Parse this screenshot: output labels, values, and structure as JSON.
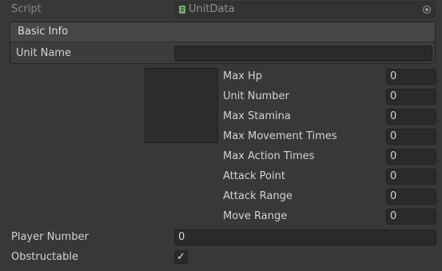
{
  "script": {
    "label": "Script",
    "value": "UnitData"
  },
  "basic_info": {
    "header": "Basic Info",
    "unit_name_label": "Unit Name",
    "unit_name_value": ""
  },
  "stats": [
    {
      "label": "Max Hp",
      "value": "0"
    },
    {
      "label": "Unit Number",
      "value": "0"
    },
    {
      "label": "Max Stamina",
      "value": "0"
    },
    {
      "label": "Max Movement Times",
      "value": "0"
    },
    {
      "label": "Max Action Times",
      "value": "0"
    },
    {
      "label": "Attack Point",
      "value": "0"
    },
    {
      "label": "Attack Range",
      "value": "0"
    },
    {
      "label": "Move Range",
      "value": "0"
    }
  ],
  "player_number": {
    "label": "Player Number",
    "value": "0"
  },
  "obstructable": {
    "label": "Obstructable",
    "checked_glyph": "✓"
  },
  "colors": {
    "background": "#383838",
    "field": "#2a2a2a",
    "script_icon": "#7aa874"
  }
}
